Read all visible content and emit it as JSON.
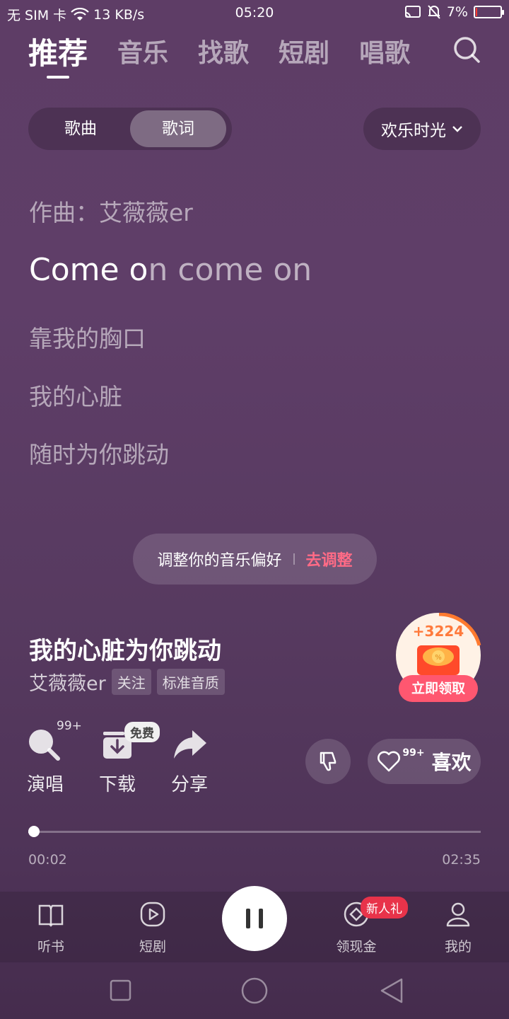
{
  "status_bar": {
    "carrier": "无 SIM 卡",
    "speed": "13 KB/s",
    "time": "05:20",
    "battery": "7%",
    "battery_level": 0.07
  },
  "top_tabs": [
    "推荐",
    "音乐",
    "找歌",
    "短剧",
    "唱歌"
  ],
  "segment": {
    "songs": "歌曲",
    "lyrics": "歌词"
  },
  "mode": "欢乐时光",
  "lyrics": {
    "composer": "作曲：艾薇薇er",
    "current_sung": "Come o",
    "current_rest": "n come on",
    "line1": "靠我的胸口",
    "line2": "我的心脏",
    "line3": "随时为你跳动"
  },
  "preference": {
    "text": "调整你的音乐偏好",
    "action": "去调整"
  },
  "song": {
    "title": "我的心脏为你跳动",
    "artist": "艾薇薇er",
    "follow": "关注",
    "quality": "标准音质"
  },
  "reward": {
    "amount": "+3224",
    "button": "立即领取"
  },
  "actions": {
    "sing": "演唱",
    "sing_count": "99+",
    "download": "下载",
    "free_badge": "免费",
    "share": "分享",
    "like": "喜欢",
    "like_count": "99+"
  },
  "progress": {
    "current": "00:02",
    "total": "02:35",
    "fraction": 0.013
  },
  "bottom_nav": {
    "audiobook": "听书",
    "short_drama": "短剧",
    "earn": "领现金",
    "earn_badge": "新人礼",
    "mine": "我的"
  }
}
